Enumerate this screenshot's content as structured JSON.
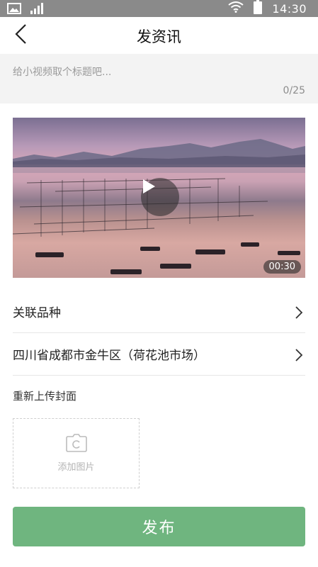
{
  "status_bar": {
    "time": "14:30"
  },
  "header": {
    "title": "发资讯"
  },
  "title_input": {
    "placeholder": "给小视频取个标题吧...",
    "value": "",
    "counter": "0/25"
  },
  "video": {
    "duration": "00:30"
  },
  "rows": [
    {
      "label": "关联品种"
    },
    {
      "label": "四川省成都市金牛区（荷花池市场）"
    }
  ],
  "cover": {
    "label": "重新上传封面",
    "add_text": "添加图片"
  },
  "publish": {
    "label": "发布"
  },
  "colors": {
    "accent": "#6fb57f",
    "status_bar": "#8a8a8a"
  }
}
